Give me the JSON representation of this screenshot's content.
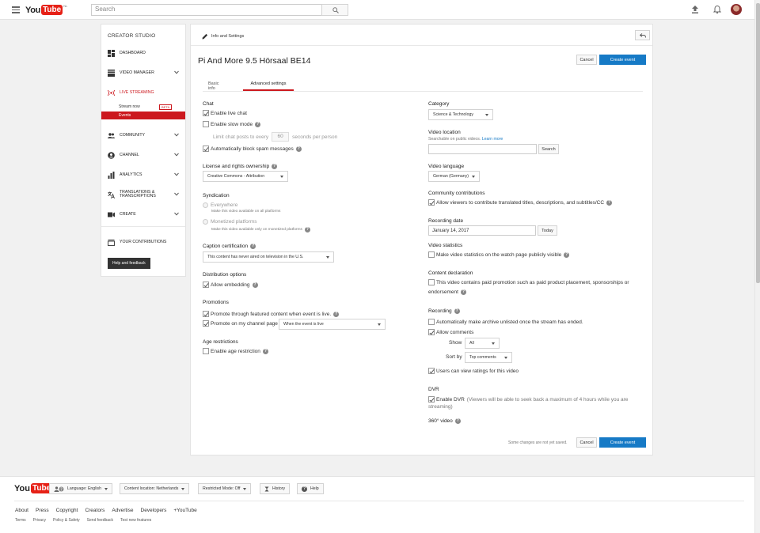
{
  "header": {
    "logo_you": "You",
    "logo_tube": "Tube",
    "logo_region": "NL",
    "search_placeholder": "Search"
  },
  "sidebar": {
    "title": "CREATOR STUDIO",
    "items": [
      {
        "label": "DASHBOARD",
        "icon": "dashboard-icon"
      },
      {
        "label": "VIDEO MANAGER",
        "icon": "video-manager-icon"
      },
      {
        "label": "LIVE STREAMING",
        "icon": "live-streaming-icon"
      },
      {
        "label": "COMMUNITY",
        "icon": "community-icon"
      },
      {
        "label": "CHANNEL",
        "icon": "channel-icon"
      },
      {
        "label": "ANALYTICS",
        "icon": "analytics-icon"
      },
      {
        "label": "TRANSLATIONS & TRANSCRIPTIONS",
        "icon": "translate-icon"
      },
      {
        "label": "CREATE",
        "icon": "create-icon"
      },
      {
        "label": "YOUR CONTRIBUTIONS",
        "icon": "contributions-icon"
      }
    ],
    "stream_now": "Stream now",
    "beta": "BETA",
    "events": "Events",
    "help_feedback": "Help and feedback"
  },
  "main": {
    "breadcrumb": "Info and Settings",
    "title": "Pi And More 9.5 Hörsaal BE14",
    "cancel": "Cancel",
    "create_event": "Create event",
    "tabs": [
      "Basic info",
      "Advanced settings"
    ],
    "left": {
      "chat": "Chat",
      "enable_live_chat": "Enable live chat",
      "enable_slow_mode": "Enable slow mode",
      "limit_chat_prefix": "Limit chat posts to every",
      "limit_chat_value": "60",
      "limit_chat_suffix": "seconds per person",
      "block_spam": "Automatically block spam messages",
      "license_title": "License and rights ownership",
      "license_value": "Creative Commons - Attribution",
      "syndication": "Syndication",
      "everywhere": "Everywhere",
      "everywhere_sub": "Make this video available on all platforms",
      "monetized": "Monetized platforms",
      "monetized_sub": "Make this video available only on monetized platforms",
      "caption_title": "Caption certification",
      "caption_value": "This content has never aired on television in the U.S.",
      "distribution": "Distribution options",
      "allow_embedding": "Allow embedding",
      "promotions": "Promotions",
      "promote_featured": "Promote through featured content when event is live.",
      "promote_channel": "Promote on my channel page",
      "promote_channel_value": "When the event is live",
      "age_title": "Age restrictions",
      "age_enable": "Enable age restriction"
    },
    "right": {
      "category": "Category",
      "category_value": "Science & Technology",
      "video_location": "Video location",
      "location_sub": "Searchable on public videos.",
      "learn_more": "Learn more",
      "search_btn": "Search",
      "video_language": "Video language",
      "language_value": "German (Germany)",
      "community": "Community contributions",
      "allow_viewers": "Allow viewers to contribute translated titles, descriptions, and subtitles/CC",
      "recording_date": "Recording date",
      "recording_date_value": "January 14, 2017",
      "today": "Today",
      "video_statistics": "Video statistics",
      "stats_public": "Make video statistics on the watch page publicly visible",
      "content_declaration": "Content declaration",
      "paid_promo_1": "This video contains paid promotion such as paid product placement, sponsorships or",
      "paid_promo_2": "endorsement",
      "recording": "Recording",
      "archive_unlisted": "Automatically make archive unlisted once the stream has ended.",
      "allow_comments": "Allow comments",
      "show_label": "Show",
      "show_value": "All",
      "sort_label": "Sort by",
      "sort_value": "Top comments",
      "view_ratings": "Users can view ratings for this video",
      "dvr": "DVR",
      "enable_dvr": "Enable DVR",
      "dvr_note_1": "(Viewers will be able to seek back a maximum of 4 hours while you are",
      "dvr_note_2": "streaming)",
      "video_360": "360° video",
      "unsaved": "Some changes are not yet saved."
    }
  },
  "footer": {
    "language": "Language: English",
    "location": "Content location: Netherlands",
    "restricted": "Restricted Mode: Off",
    "history": "History",
    "help": "Help",
    "links": [
      "About",
      "Press",
      "Copyright",
      "Creators",
      "Advertise",
      "Developers",
      "+YouTube"
    ],
    "links2": [
      "Terms",
      "Privacy",
      "Policy & Safety",
      "Send feedback",
      "Test new features"
    ]
  }
}
